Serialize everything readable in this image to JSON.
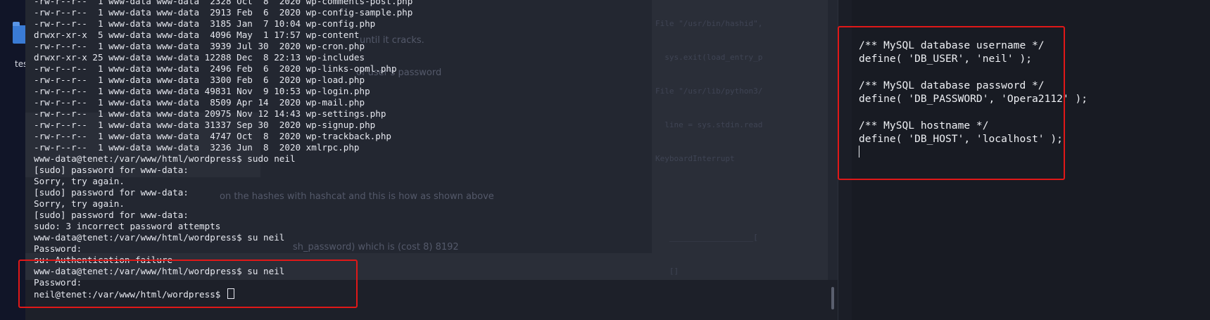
{
  "desktop": {
    "icon_name": "folder-icon",
    "label": "tes"
  },
  "terminal": {
    "lines": [
      "-rw-r--r--  1 www-data www-data  2328 Oct  8  2020 wp-comments-post.php",
      "-rw-r--r--  1 www-data www-data  2913 Feb  6  2020 wp-config-sample.php",
      "-rw-r--r--  1 www-data www-data  3185 Jan  7 10:04 wp-config.php",
      "drwxr-xr-x  5 www-data www-data  4096 May  1 17:57 wp-content",
      "-rw-r--r--  1 www-data www-data  3939 Jul 30  2020 wp-cron.php",
      "drwxr-xr-x 25 www-data www-data 12288 Dec  8 22:13 wp-includes",
      "-rw-r--r--  1 www-data www-data  2496 Feb  6  2020 wp-links-opml.php",
      "-rw-r--r--  1 www-data www-data  3300 Feb  6  2020 wp-load.php",
      "-rw-r--r--  1 www-data www-data 49831 Nov  9 10:53 wp-login.php",
      "-rw-r--r--  1 www-data www-data  8509 Apr 14  2020 wp-mail.php",
      "-rw-r--r--  1 www-data www-data 20975 Nov 12 14:43 wp-settings.php",
      "-rw-r--r--  1 www-data www-data 31337 Sep 30  2020 wp-signup.php",
      "-rw-r--r--  1 www-data www-data  4747 Oct  8  2020 wp-trackback.php",
      "-rw-r--r--  1 www-data www-data  3236 Jun  8  2020 xmlrpc.php",
      "www-data@tenet:/var/www/html/wordpress$ sudo neil",
      "[sudo] password for www-data:",
      "Sorry, try again.",
      "[sudo] password for www-data:",
      "Sorry, try again.",
      "[sudo] password for www-data:",
      "sudo: 3 incorrect password attempts",
      "www-data@tenet:/var/www/html/wordpress$ su neil",
      "Password:",
      "su: Authentication failure",
      "www-data@tenet:/var/www/html/wordpress$ su neil",
      "Password:",
      "neil@tenet:/var/www/html/wordpress$ "
    ],
    "ghost_text": [
      "until it cracks.",
      "of user's password",
      "on the hashes with hashcat and this is how as shown above",
      "sh_password) which is (cost 8) 8192"
    ],
    "ghost_code": [
      "File \"/usr/bin/hashid\",",
      "  sys.exit(load_entry_p",
      "File \"/usr/lib/python3/",
      "  line = sys.stdin.read",
      "KeyboardInterrupt",
      "",
      "",
      "   __________________[",
      "   []"
    ]
  },
  "editor": {
    "lines": [
      "/** MySQL database username */",
      "define( 'DB_USER', 'neil' );",
      "",
      "/** MySQL database password */",
      "define( 'DB_PASSWORD', 'Opera2112' );",
      "",
      "/** MySQL hostname */",
      "define( 'DB_HOST', 'localhost' );"
    ]
  },
  "colors": {
    "highlight": "#e01818",
    "terminal_bg": "#232731",
    "editor_bg": "#181b23"
  }
}
